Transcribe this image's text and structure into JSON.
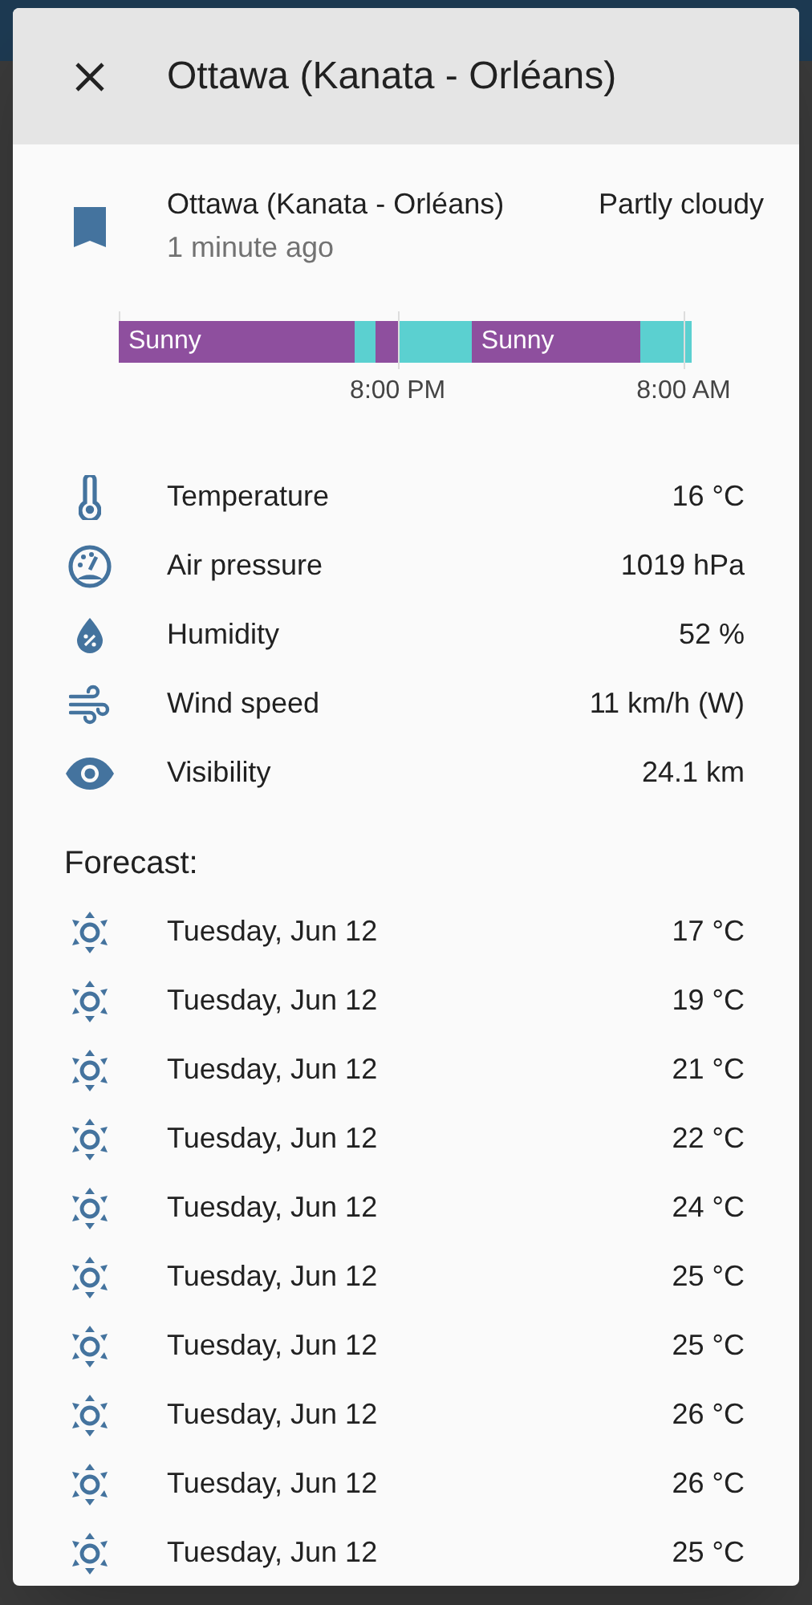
{
  "dialog": {
    "title": "Ottawa (Kanata - Orléans)"
  },
  "summary": {
    "name": "Ottawa (Kanata - Orléans)",
    "updated": "1 minute ago",
    "condition": "Partly cloudy"
  },
  "timeline": {
    "segments": [
      {
        "label": "Sunny",
        "color": "#8e4f9e"
      },
      {
        "color": "#5bd0d0"
      },
      {
        "color": "#8e4f9e"
      },
      {
        "color": "#5bd0d0"
      },
      {
        "label": "Sunny",
        "color": "#8e4f9e"
      },
      {
        "color": "#5bd0d0"
      }
    ],
    "ticks": [
      "8:00 PM",
      "8:00 AM"
    ]
  },
  "attributes": [
    {
      "kind": "temperature",
      "label": "Temperature",
      "value": "16 °C"
    },
    {
      "kind": "pressure",
      "label": "Air pressure",
      "value": "1019 hPa"
    },
    {
      "kind": "humidity",
      "label": "Humidity",
      "value": "52 %"
    },
    {
      "kind": "wind",
      "label": "Wind speed",
      "value": "11 km/h (W)"
    },
    {
      "kind": "visibility",
      "label": "Visibility",
      "value": "24.1 km"
    }
  ],
  "forecast": {
    "heading": "Forecast:",
    "items": [
      {
        "kind": "sunny",
        "date": "Tuesday, Jun 12",
        "temperature": "17 °C"
      },
      {
        "kind": "sunny",
        "date": "Tuesday, Jun 12",
        "temperature": "19 °C"
      },
      {
        "kind": "sunny",
        "date": "Tuesday, Jun 12",
        "temperature": "21 °C"
      },
      {
        "kind": "sunny",
        "date": "Tuesday, Jun 12",
        "temperature": "22 °C"
      },
      {
        "kind": "sunny",
        "date": "Tuesday, Jun 12",
        "temperature": "24 °C"
      },
      {
        "kind": "sunny",
        "date": "Tuesday, Jun 12",
        "temperature": "25 °C"
      },
      {
        "kind": "sunny",
        "date": "Tuesday, Jun 12",
        "temperature": "25 °C"
      },
      {
        "kind": "sunny",
        "date": "Tuesday, Jun 12",
        "temperature": "26 °C"
      },
      {
        "kind": "sunny",
        "date": "Tuesday, Jun 12",
        "temperature": "26 °C"
      },
      {
        "kind": "sunny",
        "date": "Tuesday, Jun 12",
        "temperature": "25 °C"
      }
    ]
  }
}
